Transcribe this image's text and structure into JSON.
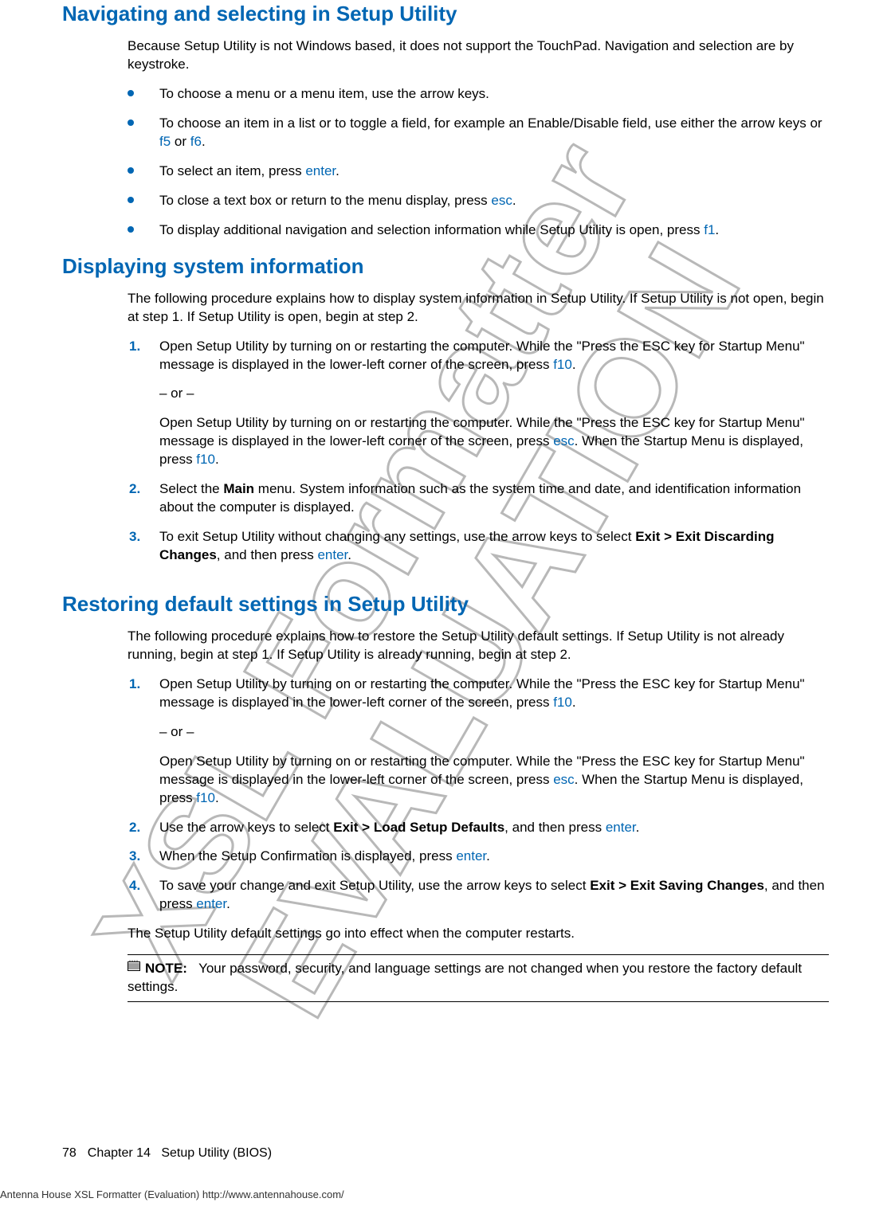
{
  "watermark": {
    "text1": "XSL Formatter",
    "text2": "EVALUATION"
  },
  "sec1": {
    "title": "Navigating and selecting in Setup Utility",
    "intro": "Because Setup Utility is not Windows based, it does not support the TouchPad. Navigation and selection are by keystroke.",
    "b1": "To choose a menu or a menu item, use the arrow keys.",
    "b2a": "To choose an item in a list or to toggle a field, for example an Enable/Disable field, use either the arrow keys or ",
    "b2_f5": "f5",
    "b2_or": " or ",
    "b2_f6": "f6",
    "b2b": ".",
    "b3a": "To select an item, press ",
    "b3_key": "enter",
    "b3b": ".",
    "b4a": "To close a text box or return to the menu display, press ",
    "b4_key": "esc",
    "b4b": ".",
    "b5a": "To display additional navigation and selection information while Setup Utility is open, press ",
    "b5_key": "f1",
    "b5b": "."
  },
  "sec2": {
    "title": "Displaying system information",
    "intro": "The following procedure explains how to display system information in Setup Utility. If Setup Utility is not open, begin at step 1. If Setup Utility is open, begin at step 2.",
    "s1a": "Open Setup Utility by turning on or restarting the computer. While the \"Press the ESC key for Startup Menu\" message is displayed in the lower-left corner of the screen, press ",
    "s1_f10a": "f10",
    "s1b": ".",
    "s1_or": "– or –",
    "s1c": "Open Setup Utility by turning on or restarting the computer. While the \"Press the ESC key for Startup Menu\" message is displayed in the lower-left corner of the screen, press ",
    "s1_esc": "esc",
    "s1d": ". When the Startup Menu is displayed, press ",
    "s1_f10b": "f10",
    "s1e": ".",
    "s2a": "Select the ",
    "s2_main": "Main",
    "s2b": " menu. System information such as the system time and date, and identification information about the computer is displayed.",
    "s3a": "To exit Setup Utility without changing any settings, use the arrow keys to select ",
    "s3_exit": "Exit > Exit Discarding Changes",
    "s3b": ", and then press ",
    "s3_enter": "enter",
    "s3c": "."
  },
  "sec3": {
    "title": "Restoring default settings in Setup Utility",
    "intro": "The following procedure explains how to restore the Setup Utility default settings. If Setup Utility is not already running, begin at step 1. If Setup Utility is already running, begin at step 2.",
    "s1a": "Open Setup Utility by turning on or restarting the computer. While the \"Press the ESC key for Startup Menu\" message is displayed in the lower-left corner of the screen, press ",
    "s1_f10a": "f10",
    "s1b": ".",
    "s1_or": "– or –",
    "s1c": "Open Setup Utility by turning on or restarting the computer. While the \"Press the ESC key for Startup Menu\" message is displayed in the lower-left corner of the screen, press ",
    "s1_esc": "esc",
    "s1d": ". When the Startup Menu is displayed, press ",
    "s1_f10b": "f10",
    "s1e": ".",
    "s2a": "Use the arrow keys to select ",
    "s2_bold": "Exit > Load Setup Defaults",
    "s2b": ", and then press ",
    "s2_enter": "enter",
    "s2c": ".",
    "s3a": "When the Setup Confirmation is displayed, press ",
    "s3_enter": "enter",
    "s3b": ".",
    "s4a": "To save your change and exit Setup Utility, use the arrow keys to select ",
    "s4_bold": "Exit > Exit Saving Changes",
    "s4b": ", and then press ",
    "s4_enter": "enter",
    "s4c": ".",
    "out": "The Setup Utility default settings go into effect when the computer restarts.",
    "note_label": "NOTE:",
    "note_text": "Your password, security, and language settings are not changed when you restore the factory default settings."
  },
  "footer": {
    "page": "78",
    "chapter": "Chapter 14",
    "title": "Setup Utility (BIOS)"
  },
  "eval": "Antenna House XSL Formatter (Evaluation)  http://www.antennahouse.com/"
}
